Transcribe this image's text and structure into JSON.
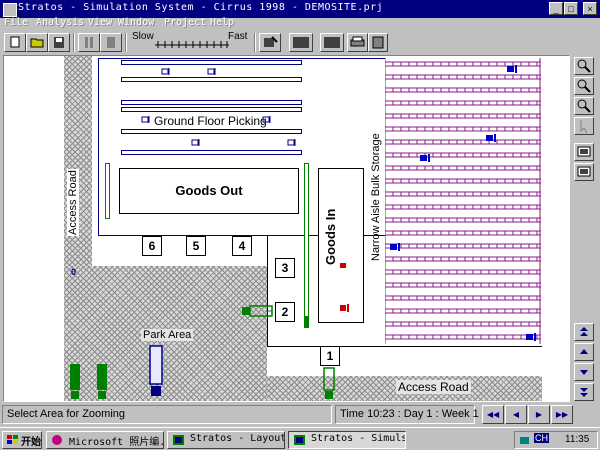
{
  "window": {
    "title": "Stratos - Simulation System - Cirrus 1998 - DEMOSITE.prj",
    "controls": {
      "minimize": "_",
      "maximize": "□",
      "close": "×"
    }
  },
  "menu": [
    {
      "label": "File"
    },
    {
      "label": "Analysis"
    },
    {
      "label": "View"
    },
    {
      "label": "Window"
    },
    {
      "label": "Project"
    },
    {
      "label": "Help"
    }
  ],
  "toolbar": {
    "speed_slow_label": "Slow",
    "speed_fast_label": "Fast"
  },
  "layout": {
    "access_road_vertical": "Access Road",
    "access_road_bottom": "Access Road",
    "ground_floor_picking": "Ground Floor Picking",
    "goods_out": "Goods Out",
    "goods_in": "Goods In",
    "narrow_aisle": "Narrow Aisle Bulk Storage",
    "park_area": "Park Area",
    "dock_labels": [
      "6",
      "5",
      "4",
      "3",
      "2",
      "1"
    ],
    "corner_marker": "0"
  },
  "status": {
    "message": "Select Area for Zooming",
    "time": "Time 10:23 : Day 1 : Week 1"
  },
  "taskbar": {
    "start_label": "开始",
    "tasks": [
      {
        "label": "Microsoft 照片编..."
      },
      {
        "label": "Stratos - Layout..."
      },
      {
        "label": "Stratos - Simuls..."
      }
    ],
    "tray_lang": "CH",
    "clock": "11:35"
  },
  "colors": {
    "title_bar": "#000080",
    "rack_blue": "#000080",
    "rack_purple": "#8b1a8b",
    "forklift_blue": "#0000cc",
    "forklift_red": "#cc0000",
    "truck_green": "#008000"
  }
}
